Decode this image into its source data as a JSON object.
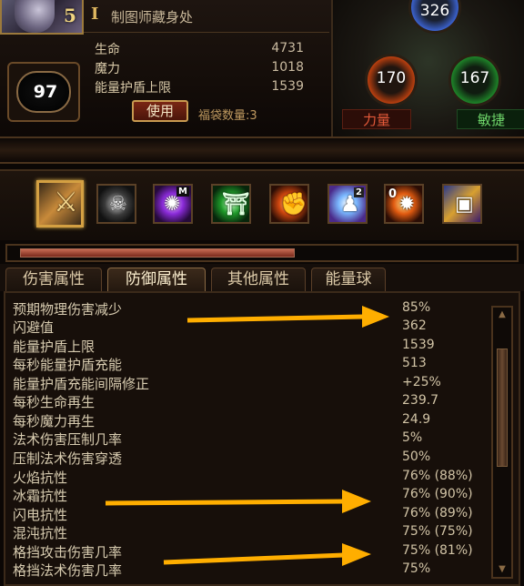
{
  "header": {
    "portrait_level": "5",
    "title_roman": "I",
    "title": "制图师藏身处"
  },
  "level": "97",
  "stats": [
    {
      "label": "生命",
      "value": "4731"
    },
    {
      "label": "魔力",
      "value": "1018"
    },
    {
      "label": "能量护盾上限",
      "value": "1539"
    }
  ],
  "use_button": "使用",
  "bag_text": "福袋数量:3",
  "attributes": {
    "intelligence": "326",
    "strength": "170",
    "dexterity": "167",
    "strength_label": "力量",
    "dexterity_label": "敏捷"
  },
  "skills": [
    {
      "icon": "sword-icon",
      "active": true
    },
    {
      "icon": "ghost-icon"
    },
    {
      "icon": "vortex-icon",
      "badge": "M"
    },
    {
      "icon": "shrine-icon"
    },
    {
      "icon": "fire-fist-icon"
    },
    {
      "icon": "ice-figure-icon",
      "badge": "2"
    },
    {
      "icon": "fire-burst-icon",
      "badge": "0"
    },
    {
      "icon": "tome-icon"
    }
  ],
  "xp_progress": 0.56,
  "tabs": [
    {
      "label": "伤害属性",
      "active": false
    },
    {
      "label": "防御属性",
      "active": true
    },
    {
      "label": "其他属性",
      "active": false
    },
    {
      "label": "能量球",
      "active": false
    }
  ],
  "defense": [
    {
      "label": "预期物理伤害减少",
      "value": "85%"
    },
    {
      "label": "闪避值",
      "value": "362"
    },
    {
      "label": "能量护盾上限",
      "value": "1539"
    },
    {
      "label": "每秒能量护盾充能",
      "value": "513"
    },
    {
      "label": "能量护盾充能间隔修正",
      "value": "+25%"
    },
    {
      "label": "每秒生命再生",
      "value": "239.7"
    },
    {
      "label": "每秒魔力再生",
      "value": "24.9"
    },
    {
      "label": "法术伤害压制几率",
      "value": "5%"
    },
    {
      "label": "压制法术伤害穿透",
      "value": "50%"
    },
    {
      "label": "火焰抗性",
      "value": "76% (88%)"
    },
    {
      "label": "冰霜抗性",
      "value": "76% (90%)"
    },
    {
      "label": "闪电抗性",
      "value": "76% (89%)"
    },
    {
      "label": "混沌抗性",
      "value": "75% (75%)"
    },
    {
      "label": "格挡攻击伤害几率",
      "value": "75% (81%)"
    },
    {
      "label": "格挡法术伤害几率",
      "value": "75%"
    }
  ],
  "colors": {
    "accent": "#d4a042",
    "highlight_arrow": "#ffae00",
    "strength": "#e65a3a",
    "dexterity": "#6fd66a",
    "intelligence": "#3d66d8"
  }
}
